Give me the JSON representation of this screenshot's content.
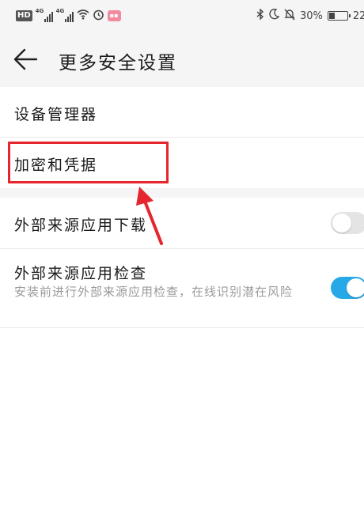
{
  "status_bar": {
    "hd": "HD",
    "signal1": "4G",
    "signal2": "4G",
    "battery_pct": "30%",
    "clock": "22:"
  },
  "header": {
    "title": "更多安全设置"
  },
  "settings": {
    "device_manager": "设备管理器",
    "encryption_credentials": "加密和凭据",
    "external_download": {
      "label": "外部来源应用下载",
      "enabled": false
    },
    "external_check": {
      "label": "外部来源应用检查",
      "description": "安装前进行外部来源应用检查，在线识别潜在风险",
      "enabled": true
    }
  },
  "colors": {
    "accent": "#27a9e8",
    "highlight": "#e5262e",
    "header_bg": "#f5f5f5"
  }
}
